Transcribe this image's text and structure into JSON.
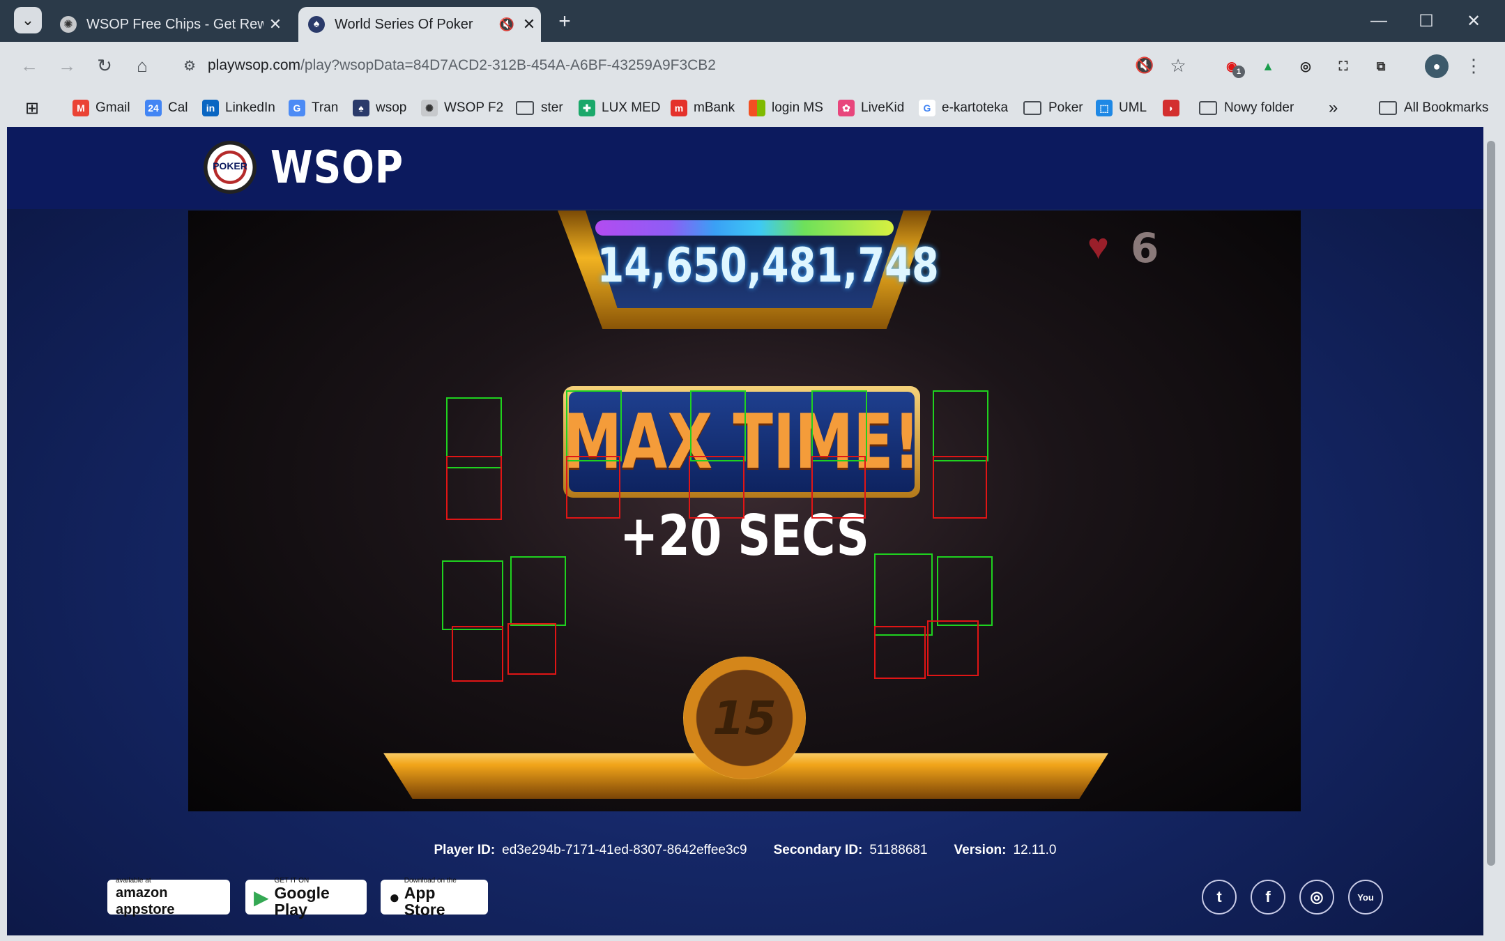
{
  "browser": {
    "tabs": [
      {
        "title": "WSOP Free Chips - Get Reward",
        "active": false
      },
      {
        "title": "World Series Of Poker",
        "active": true
      }
    ],
    "url_host": "playwsop.com",
    "url_path": "/play?wsopData=84D7ACD2-312B-454A-A6BF-43259A9F3CB2",
    "extension_badge": "1",
    "bookmarks": [
      {
        "label": "Gmail"
      },
      {
        "label": "Cal"
      },
      {
        "label": "LinkedIn"
      },
      {
        "label": "Tran"
      },
      {
        "label": "wsop"
      },
      {
        "label": "WSOP F2"
      },
      {
        "label": "ster"
      },
      {
        "label": "LUX MED"
      },
      {
        "label": "mBank"
      },
      {
        "label": "login MS"
      },
      {
        "label": "LiveKid"
      },
      {
        "label": "e-kartoteka"
      },
      {
        "label": "Poker"
      },
      {
        "label": "UML"
      },
      {
        "label": "Nowy folder"
      },
      {
        "label": "All Bookmarks"
      }
    ]
  },
  "site": {
    "logo_chip_text": "POKER",
    "logo_text": "WSOP"
  },
  "game": {
    "chip_count": "14,650,481,748",
    "hearts": "6",
    "banner": "MAX TIME!",
    "bonus": "+20 SECS",
    "timer": "15"
  },
  "footer": {
    "player_id_label": "Player ID:",
    "player_id": "ed3e294b-7171-41ed-8307-8642effee3c9",
    "secondary_id_label": "Secondary ID:",
    "secondary_id": "51188681",
    "version_label": "Version:",
    "version": "12.11.0",
    "stores": [
      {
        "small": "available at",
        "big": "amazon appstore"
      },
      {
        "small": "GET IT ON",
        "big": "Google Play"
      },
      {
        "small": "Download on the",
        "big": "App Store"
      }
    ],
    "social": [
      "twitter-icon",
      "facebook-icon",
      "instagram-icon",
      "youtube-icon"
    ]
  },
  "colors": {
    "accent_blue": "#0c1a5e",
    "gold": "#f2b321",
    "box_green": "#1fd21f",
    "box_red": "#e01515"
  }
}
